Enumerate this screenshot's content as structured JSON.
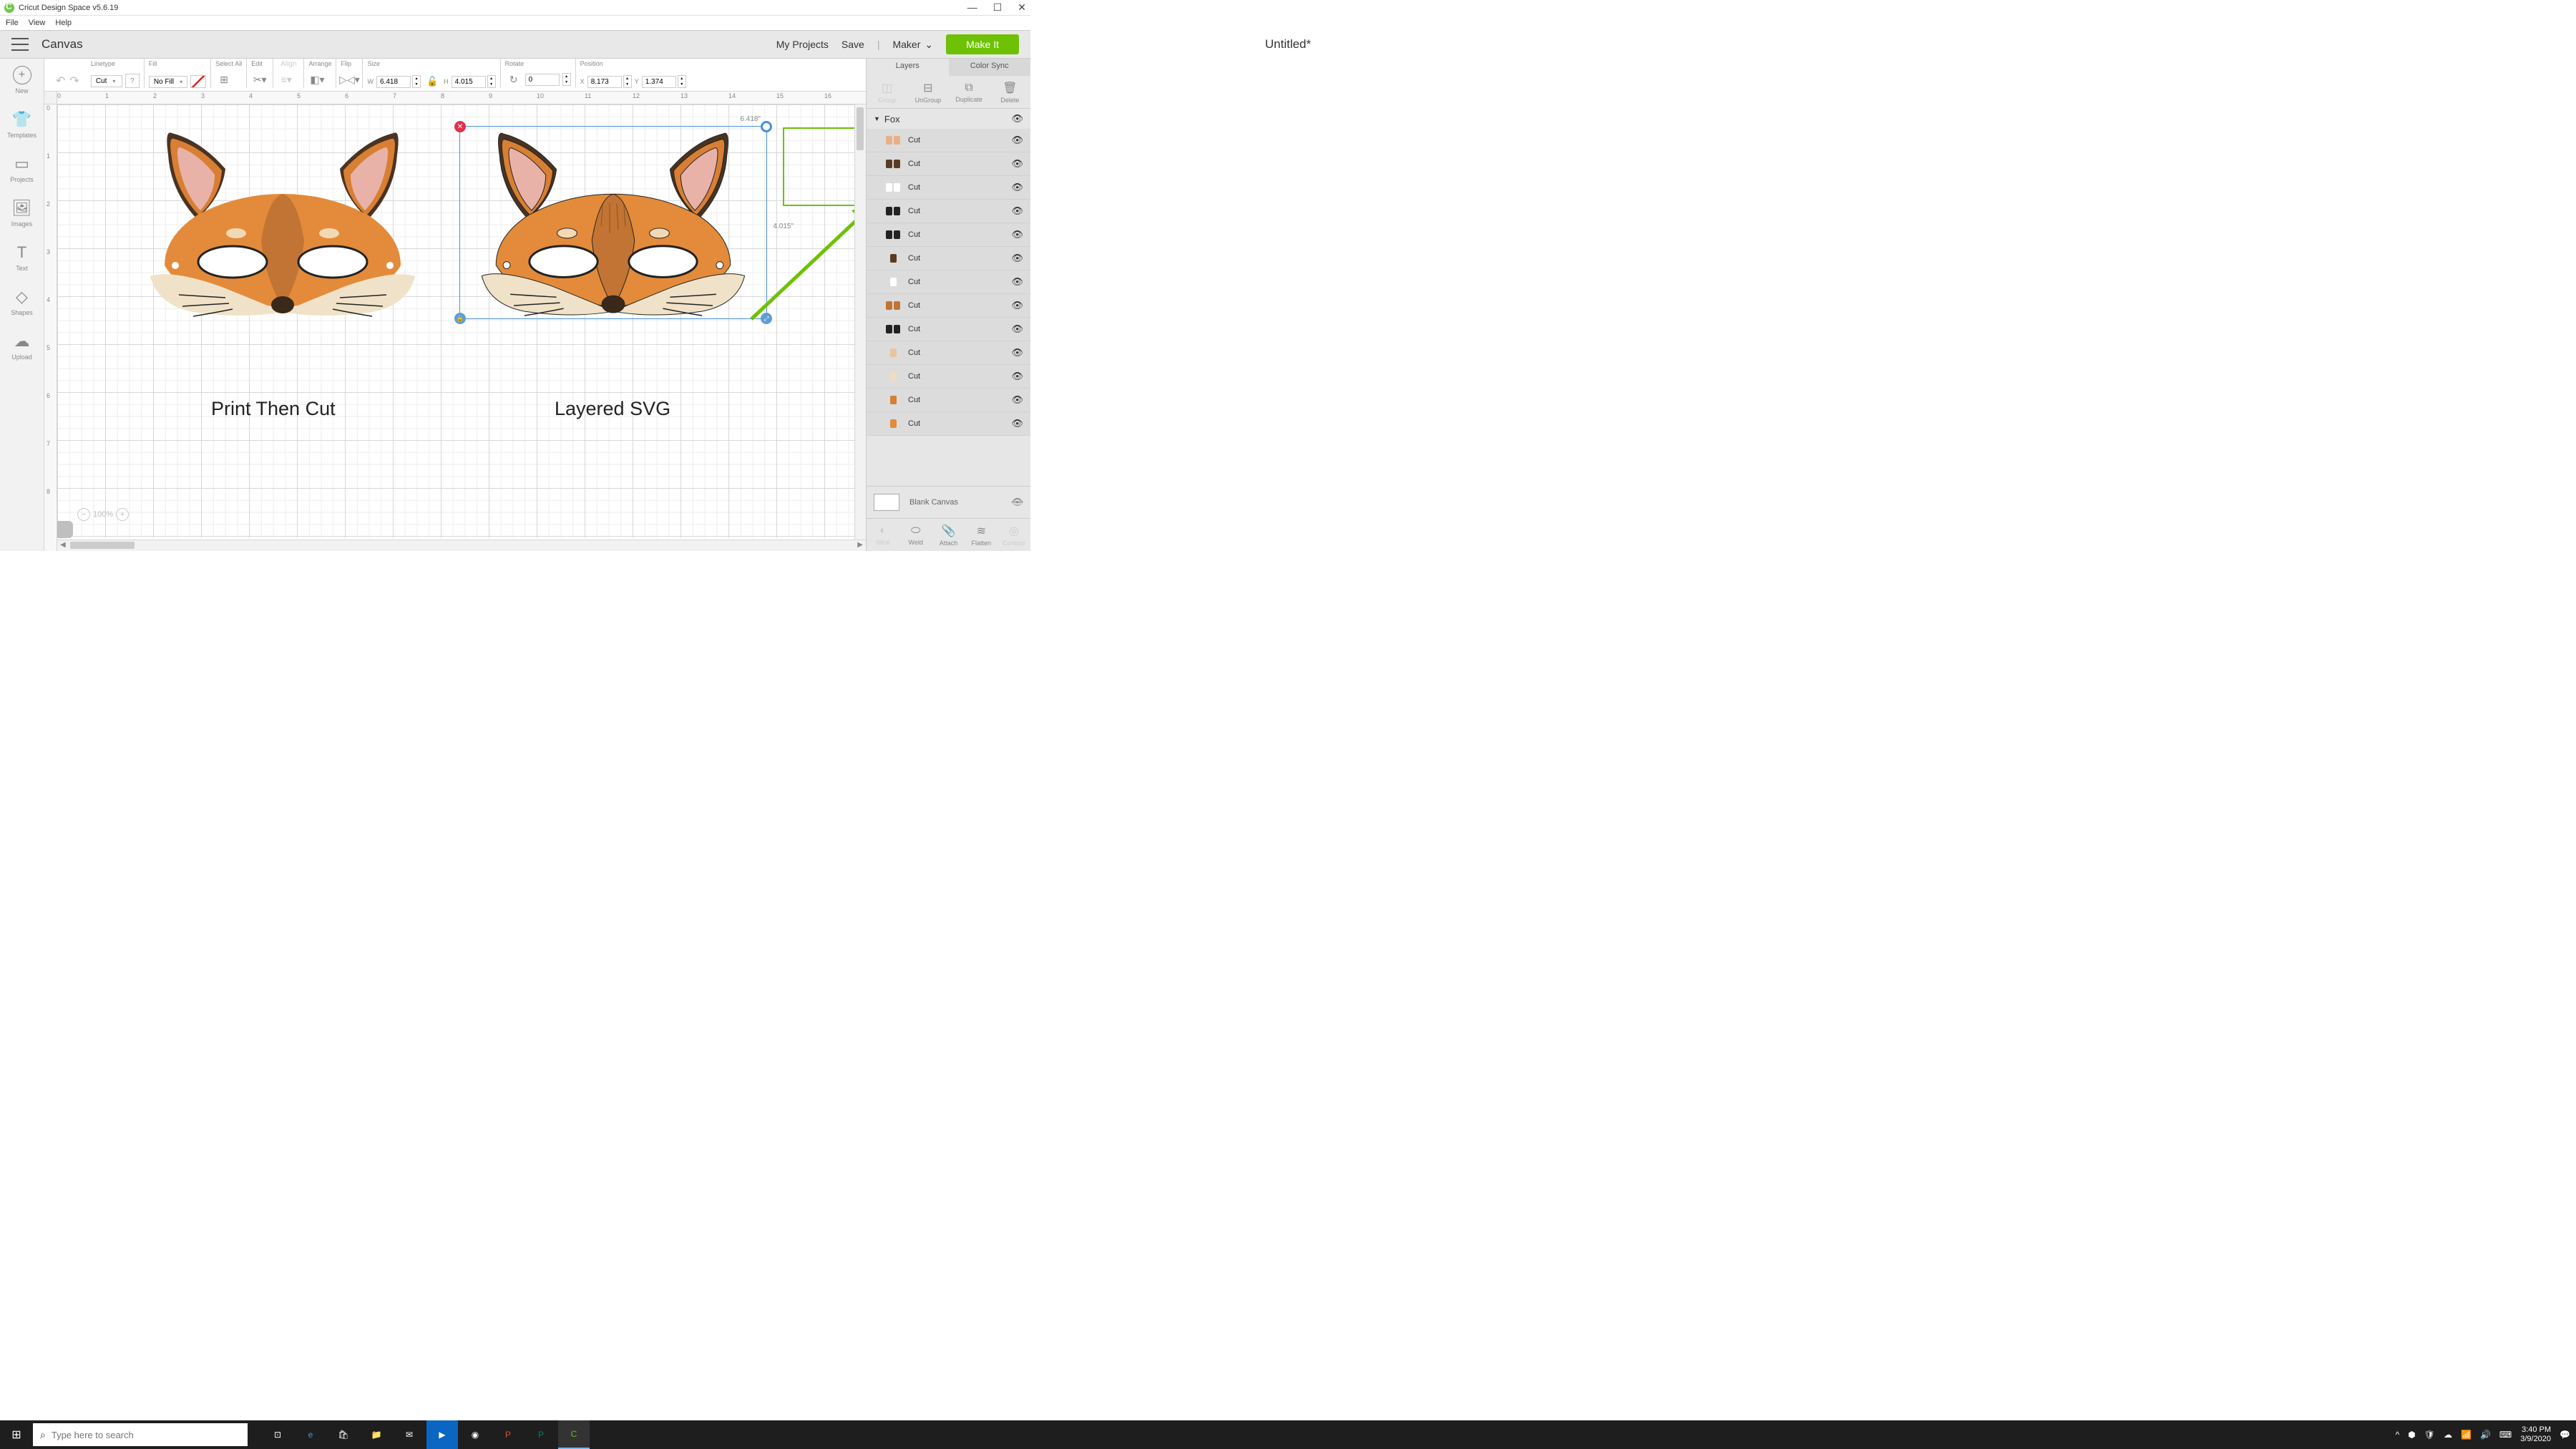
{
  "window": {
    "title": "Cricut Design Space  v5.6.19"
  },
  "menu": {
    "file": "File",
    "view": "View",
    "help": "Help"
  },
  "topnav": {
    "canvas": "Canvas",
    "doc_title": "Untitled*",
    "my_projects": "My Projects",
    "save": "Save",
    "machine": "Maker",
    "makeit": "Make It"
  },
  "leftbar": {
    "new": "New",
    "templates": "Templates",
    "projects": "Projects",
    "images": "Images",
    "text": "Text",
    "shapes": "Shapes",
    "upload": "Upload"
  },
  "toolbar": {
    "linetype_label": "Linetype",
    "linetype": "Cut",
    "info": "?",
    "fill_label": "Fill",
    "fill": "No Fill",
    "select_all": "Select All",
    "edit": "Edit",
    "align": "Align",
    "arrange": "Arrange",
    "flip": "Flip",
    "size_label": "Size",
    "w": "W",
    "w_val": "6.418",
    "h": "H",
    "h_val": "4.015",
    "rotate_label": "Rotate",
    "rotate_val": "0",
    "position_label": "Position",
    "x": "X",
    "x_val": "8.173",
    "y": "Y",
    "y_val": "1.374"
  },
  "ruler_h": [
    "0",
    "1",
    "2",
    "3",
    "4",
    "5",
    "6",
    "7",
    "8",
    "9",
    "10",
    "11",
    "12",
    "13",
    "14",
    "15",
    "16"
  ],
  "ruler_v": [
    "0",
    "1",
    "2",
    "3",
    "4",
    "5",
    "6",
    "7",
    "8"
  ],
  "canvas": {
    "sel_w": "6.418\"",
    "sel_h": "4.015\"",
    "label1": "Print Then Cut",
    "label2": "Layered SVG",
    "zoom": "100%"
  },
  "rightpanel": {
    "tab_layers": "Layers",
    "tab_colorsync": "Color Sync",
    "group": "Group",
    "ungroup": "UnGroup",
    "duplicate": "Duplicate",
    "delete": "Delete",
    "group_name": "Fox",
    "layers": [
      {
        "name": "Cut",
        "colors": [
          "#e9b088",
          "#e9b088"
        ]
      },
      {
        "name": "Cut",
        "colors": [
          "#5a3b25",
          "#5a3b25"
        ]
      },
      {
        "name": "Cut",
        "colors": [
          "#fff",
          "#fff"
        ]
      },
      {
        "name": "Cut",
        "colors": [
          "#222",
          "#222"
        ]
      },
      {
        "name": "Cut",
        "colors": [
          "#222",
          "#222"
        ]
      },
      {
        "name": "Cut",
        "colors": [
          "#5a3b25"
        ]
      },
      {
        "name": "Cut",
        "colors": [
          "#fff"
        ]
      },
      {
        "name": "Cut",
        "colors": [
          "#c27434",
          "#c27434"
        ]
      },
      {
        "name": "Cut",
        "colors": [
          "#222",
          "#222"
        ]
      },
      {
        "name": "Cut",
        "colors": [
          "#e8c59e"
        ]
      },
      {
        "name": "Cut",
        "colors": [
          "#f0dcc0"
        ]
      },
      {
        "name": "Cut",
        "colors": [
          "#d87f33"
        ]
      },
      {
        "name": "Cut",
        "colors": [
          "#e38b3a"
        ]
      }
    ],
    "blank": "Blank Canvas",
    "slice": "Slice",
    "weld": "Weld",
    "attach": "Attach",
    "flatten": "Flatten",
    "contour": "Contour"
  },
  "taskbar": {
    "search_ph": "Type here to search",
    "time": "3:40 PM",
    "date": "3/9/2020"
  }
}
